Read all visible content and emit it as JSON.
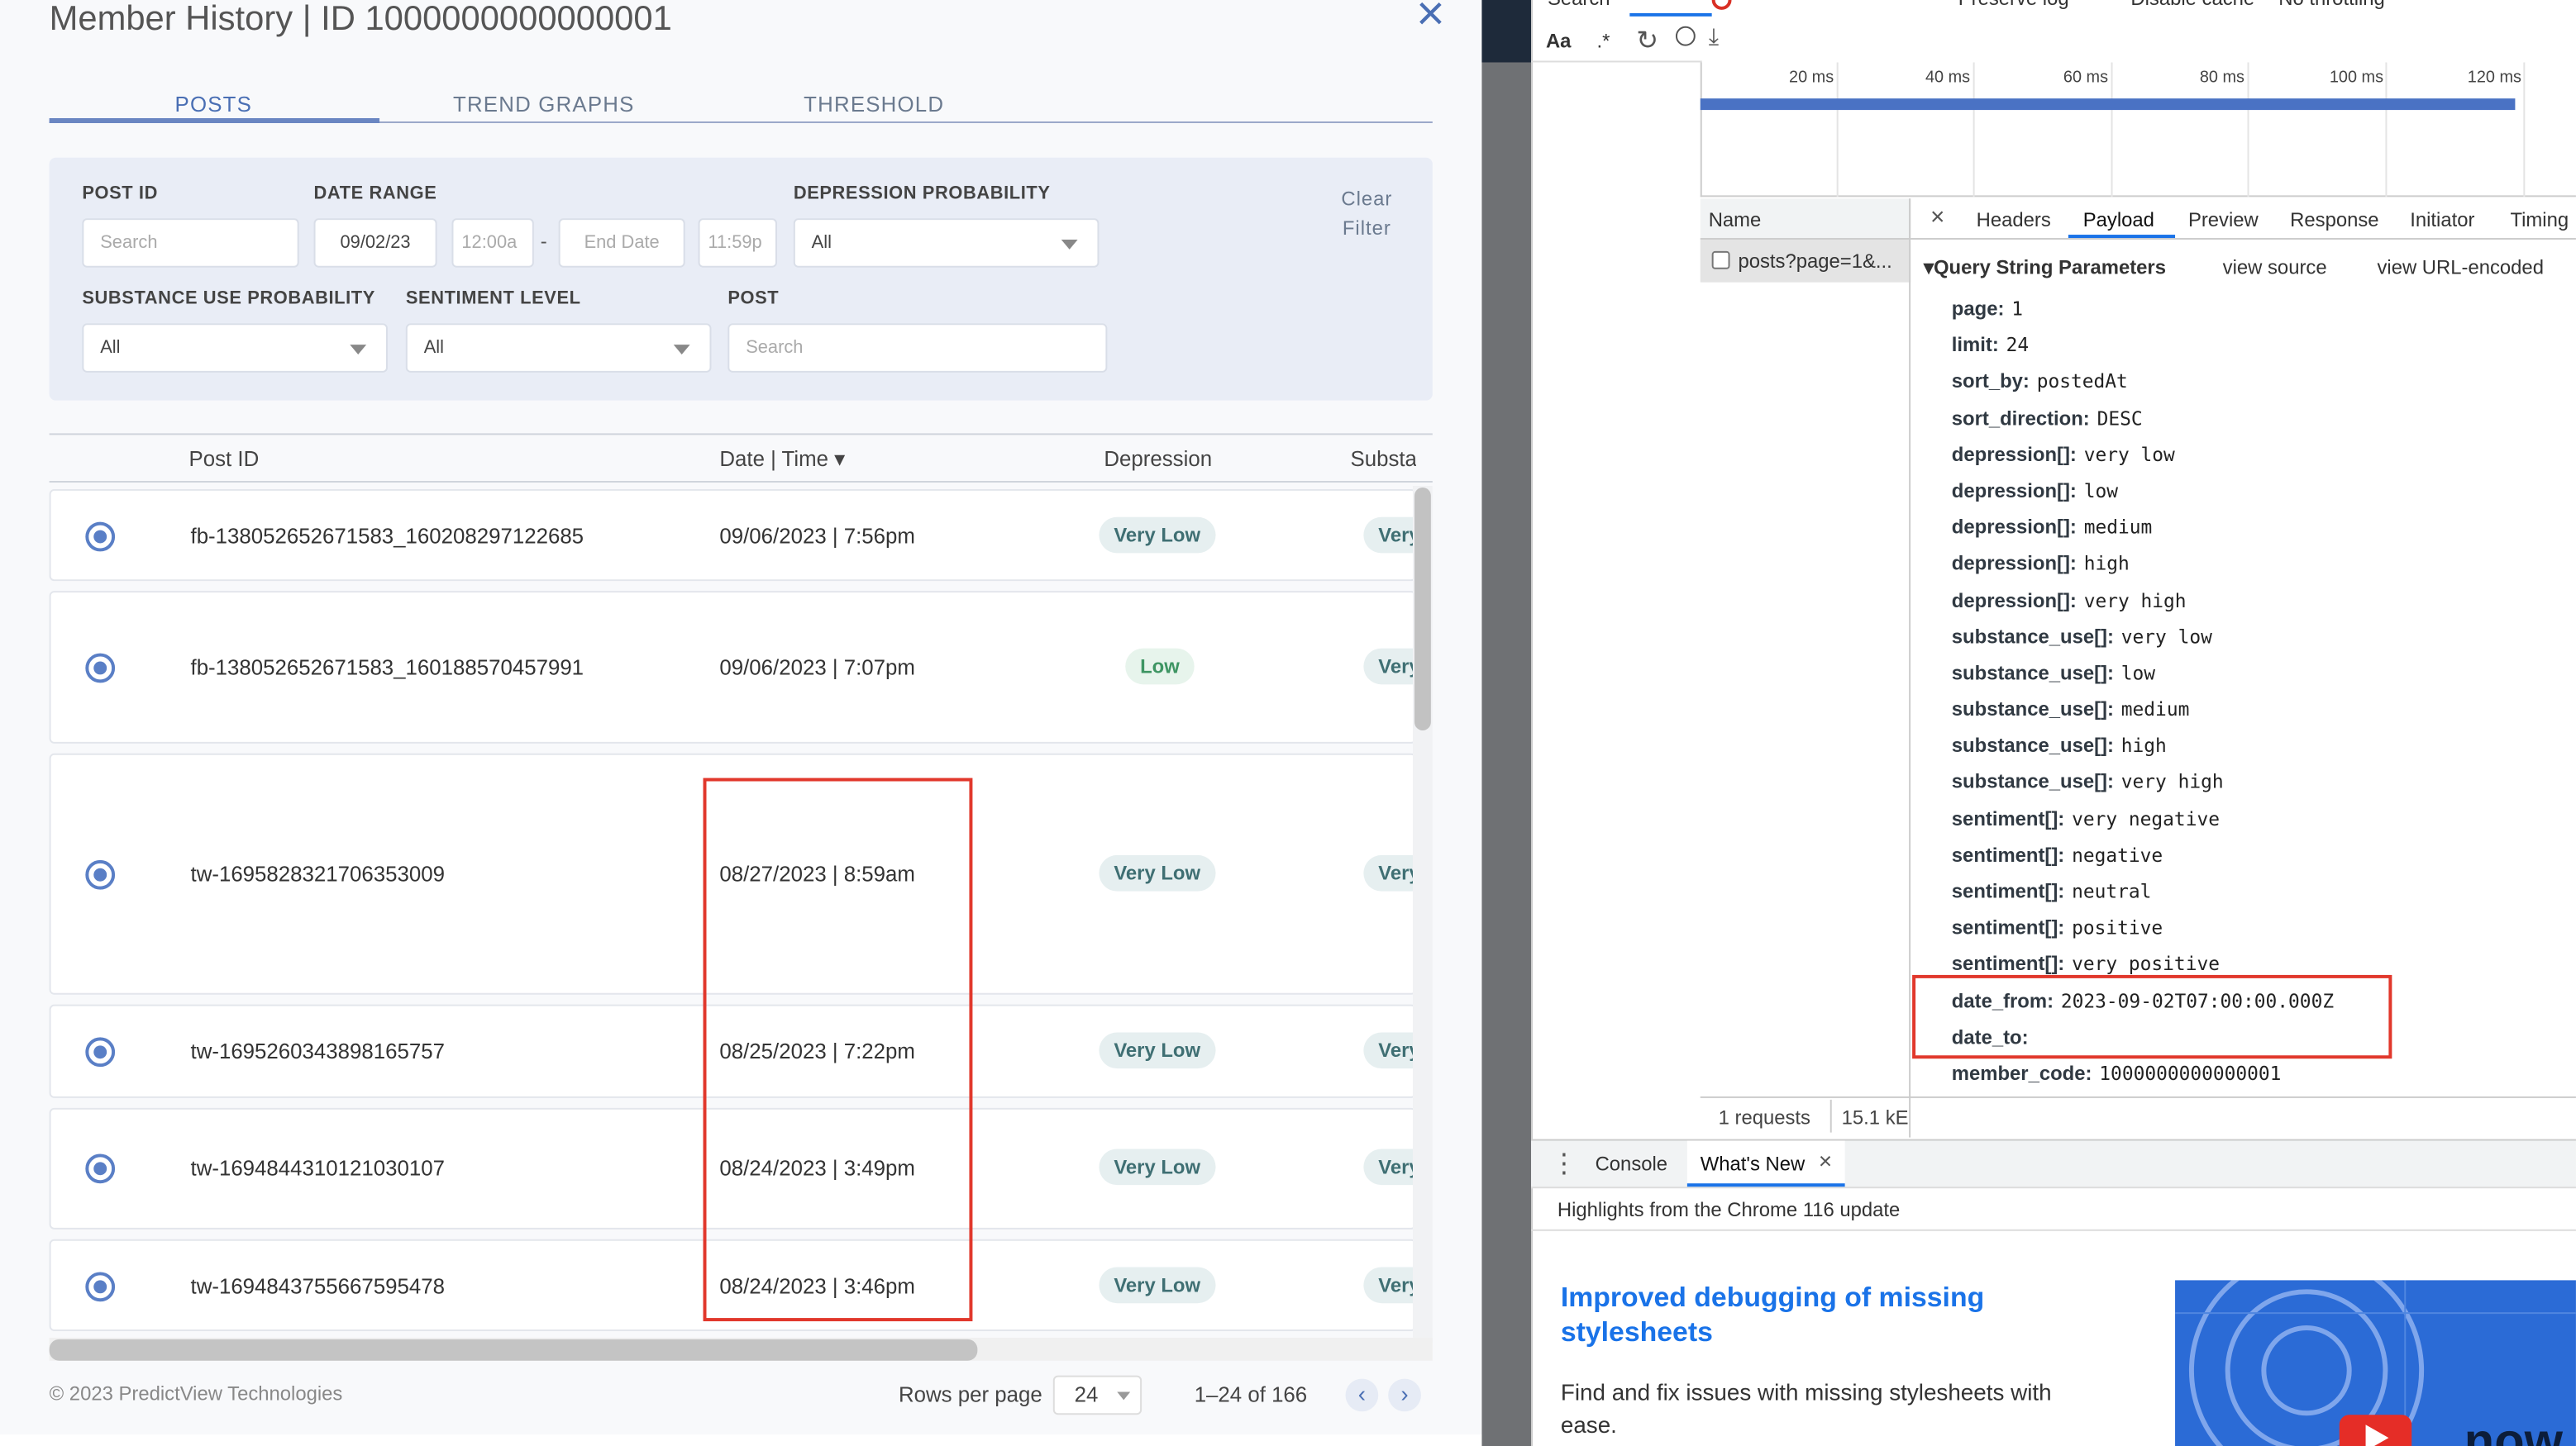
{
  "modal": {
    "title": "Member History | ID 1000000000000001",
    "close_icon": "×",
    "tabs": [
      "POSTS",
      "TREND GRAPHS",
      "THRESHOLD"
    ],
    "active_tab": "POSTS",
    "filters": {
      "post_id": {
        "label": "POST ID",
        "placeholder": "Search"
      },
      "date_range": {
        "label": "DATE RANGE",
        "start_date": "09/02/23",
        "start_time": "12:00a",
        "separator": "-",
        "end_date_placeholder": "End Date",
        "end_time": "11:59p"
      },
      "depression": {
        "label": "DEPRESSION PROBABILITY",
        "value": "All"
      },
      "substance": {
        "label": "SUBSTANCE USE PROBABILITY",
        "value": "All"
      },
      "sentiment": {
        "label": "SENTIMENT LEVEL",
        "value": "All"
      },
      "post": {
        "label": "POST",
        "placeholder": "Search"
      },
      "clear_line1": "Clear",
      "clear_line2": "Filter"
    },
    "table": {
      "headers": [
        "Post ID",
        "Date | Time ▾",
        "Depression",
        "Substa"
      ],
      "rows": [
        {
          "post_id": "fb-138052652671583_160208297122685",
          "datetime": "09/06/2023 | 7:56pm",
          "depression": "Very Low",
          "substance": "Very"
        },
        {
          "post_id": "fb-138052652671583_160188570457991",
          "datetime": "09/06/2023 | 7:07pm",
          "depression": "Low",
          "substance": "Very"
        },
        {
          "post_id": "tw-1695828321706353009",
          "datetime": "08/27/2023 | 8:59am",
          "depression": "Very Low",
          "substance": "Very"
        },
        {
          "post_id": "tw-1695260343898165757",
          "datetime": "08/25/2023 | 7:22pm",
          "depression": "Very Low",
          "substance": "Very"
        },
        {
          "post_id": "tw-1694844310121030107",
          "datetime": "08/24/2023 | 3:49pm",
          "depression": "Very Low",
          "substance": "Very"
        },
        {
          "post_id": "tw-1694843755667595478",
          "datetime": "08/24/2023 | 3:46pm",
          "depression": "Very Low",
          "substance": "Very"
        }
      ]
    },
    "footer": {
      "copyright": "© 2023 PredictView Technologies",
      "rows_per_page_label": "Rows per page",
      "rows_per_page": "24",
      "range": "1–24 of 166",
      "prev_icon": "‹",
      "next_icon": "›"
    }
  },
  "devtools": {
    "top_partial": {
      "search": "Search",
      "preserve_log": "Preserve log",
      "disable_cache": "Disable cache",
      "throttling": "No throttling"
    },
    "search_tools": {
      "aa": "Aa",
      "regex": ".*"
    },
    "timeline_ticks": [
      "20 ms",
      "40 ms",
      "60 ms",
      "80 ms",
      "100 ms",
      "120 ms"
    ],
    "name_header": "Name",
    "request_name": "posts?page=1&...",
    "panel_tabs": [
      "Headers",
      "Payload",
      "Preview",
      "Response",
      "Initiator",
      "Timing"
    ],
    "active_panel_tab": "Payload",
    "section_title": "▾Query String Parameters",
    "view_source": "view source",
    "view_url_encoded": "view URL-encoded",
    "params": [
      {
        "key": "page:",
        "value": "1"
      },
      {
        "key": "limit:",
        "value": "24"
      },
      {
        "key": "sort_by:",
        "value": "postedAt"
      },
      {
        "key": "sort_direction:",
        "value": "DESC"
      },
      {
        "key": "depression[]:",
        "value": "very low"
      },
      {
        "key": "depression[]:",
        "value": "low"
      },
      {
        "key": "depression[]:",
        "value": "medium"
      },
      {
        "key": "depression[]:",
        "value": "high"
      },
      {
        "key": "depression[]:",
        "value": "very high"
      },
      {
        "key": "substance_use[]:",
        "value": "very low"
      },
      {
        "key": "substance_use[]:",
        "value": "low"
      },
      {
        "key": "substance_use[]:",
        "value": "medium"
      },
      {
        "key": "substance_use[]:",
        "value": "high"
      },
      {
        "key": "substance_use[]:",
        "value": "very high"
      },
      {
        "key": "sentiment[]:",
        "value": "very negative"
      },
      {
        "key": "sentiment[]:",
        "value": "negative"
      },
      {
        "key": "sentiment[]:",
        "value": "neutral"
      },
      {
        "key": "sentiment[]:",
        "value": "positive"
      },
      {
        "key": "sentiment[]:",
        "value": "very positive"
      },
      {
        "key": "date_from:",
        "value": "2023-09-02T07:00:00.000Z"
      },
      {
        "key": "date_to:",
        "value": ""
      },
      {
        "key": "member_code:",
        "value": "1000000000000001"
      }
    ],
    "status": {
      "requests": "1 requests",
      "size": "15.1 kE"
    },
    "drawer_tabs": [
      "Console",
      "What's New"
    ],
    "drawer_menu_icon": "⋮",
    "close_icon": "×",
    "whats_new": {
      "highlight": "Highlights from the Chrome 116 update",
      "title": "Improved debugging of missing stylesheets",
      "desc": "Find and fix issues with missing stylesheets with ease.",
      "image_text": "now"
    }
  },
  "colors": {
    "accent": "#4a6fb4",
    "highlight": "#e1382c",
    "link": "#1a73e8"
  }
}
